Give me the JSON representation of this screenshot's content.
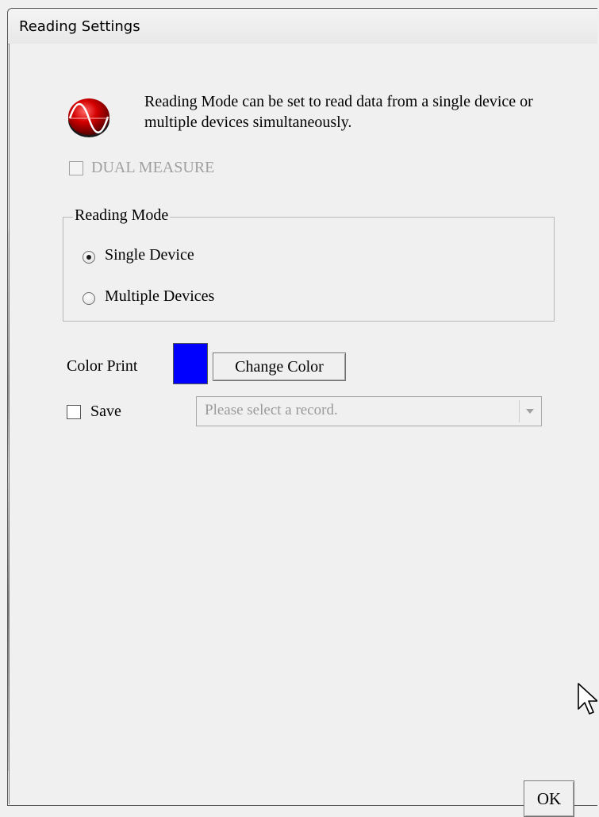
{
  "window": {
    "title": "Reading Settings"
  },
  "info": {
    "icon": "red-sine-wave-icon",
    "text": "Reading Mode can be set to read data from a single device or multiple devices simultaneously."
  },
  "dual_measure": {
    "label": "DUAL MEASURE",
    "checked": false,
    "enabled": false
  },
  "reading_mode": {
    "title": "Reading Mode",
    "options": [
      {
        "label": "Single Device",
        "selected": true
      },
      {
        "label": "Multiple Devices",
        "selected": false
      }
    ]
  },
  "color_print": {
    "label": "Color Print",
    "color": "#0000ff",
    "button_label": "Change Color"
  },
  "save": {
    "label": "Save",
    "checked": false
  },
  "record_select": {
    "placeholder": "Please select a record.",
    "enabled": false
  },
  "ok_button": {
    "label": "OK"
  }
}
